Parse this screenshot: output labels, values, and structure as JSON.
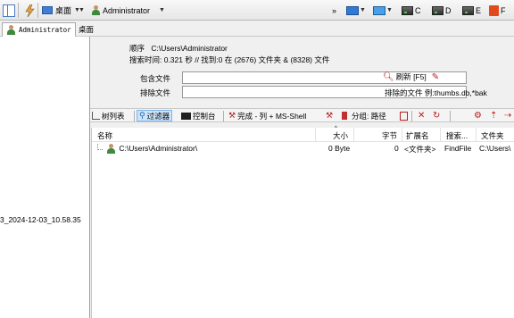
{
  "toolbar": {
    "location": "桌面",
    "user": "Administrator",
    "drives": [
      "C",
      "D",
      "E",
      "F"
    ]
  },
  "tabs": [
    {
      "label": "Administrator"
    },
    {
      "label": "桌面"
    }
  ],
  "left_pane": {
    "item": "3_2024-12-03_10.58.35"
  },
  "info": {
    "order_label": "顺序",
    "order_value": "C:\\Users\\Administrator",
    "search_time_line": "搜索时间: 0.321 秒 //  找到:0 在 (2676) 文件夹 & (8328) 文件",
    "include_label": "包含文件",
    "include_value": "",
    "exclude_label": "排除文件",
    "exclude_value": "",
    "refresh_label": "刷新 [F5]",
    "exclude_hint": "排除的文件 例:thumbs.db,*bak"
  },
  "filter_toolbar": {
    "tree": "树列表",
    "filter": "过滤器",
    "console": "控制台",
    "complete": "完成 - 列 + MS-Shell",
    "group": "分组: 路径"
  },
  "columns": [
    "名称",
    "大小",
    "字节",
    "扩展名",
    "搜索...",
    "文件夹"
  ],
  "rows": [
    {
      "name": "C:\\Users\\Administrator\\",
      "size": "0 Byte",
      "bytes": "0",
      "ext": "<文件夹>",
      "search": "FindFile",
      "folder": "C:\\Users\\"
    }
  ]
}
